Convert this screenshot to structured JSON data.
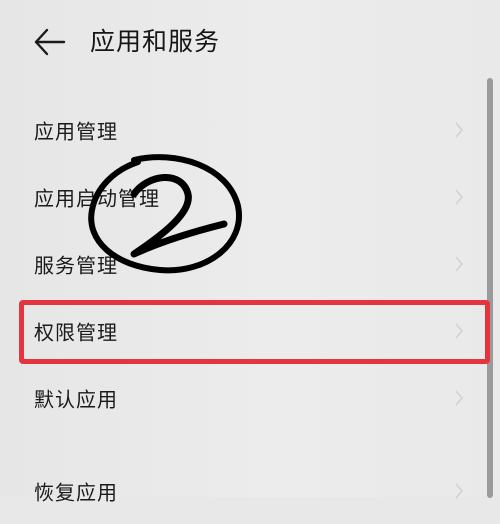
{
  "header": {
    "back_icon": "arrow-left-icon",
    "title": "应用和服务"
  },
  "menu": {
    "items": [
      {
        "label": "应用管理"
      },
      {
        "label": "应用启动管理"
      },
      {
        "label": "服务管理"
      },
      {
        "label": "权限管理"
      },
      {
        "label": "默认应用"
      },
      {
        "label": "恢复应用"
      }
    ]
  },
  "annotations": {
    "highlight_color": "#e4343f",
    "scribble_color": "#000000",
    "step_mark_icon": "circled-2-icon"
  },
  "colors": {
    "background": "#e8e8e8",
    "text": "#1a1a1a"
  }
}
